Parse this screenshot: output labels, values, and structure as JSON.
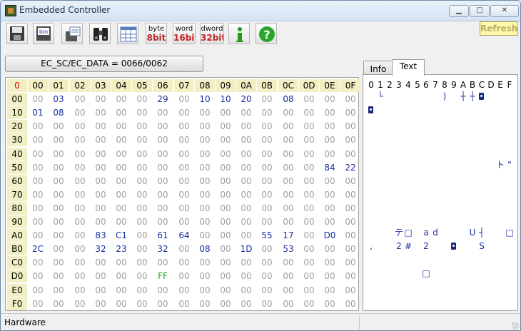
{
  "window": {
    "title": "Embedded Controller"
  },
  "toolbar": {
    "buttons": [
      {
        "icon": "save-icon"
      },
      {
        "label_top": "bin",
        "icon": "binary-file-icon"
      },
      {
        "icon": "open-file-icon"
      },
      {
        "icon": "binoculars-icon"
      },
      {
        "icon": "grid-view-icon"
      },
      {
        "label_top": "byte",
        "label_bottom": "8bit",
        "color": "#c0282a"
      },
      {
        "label_top": "word",
        "label_bottom": "16bit",
        "color": "#c0282a"
      },
      {
        "label_top": "dword",
        "label_bottom": "32bit",
        "color": "#c0282a"
      },
      {
        "icon": "info-icon"
      },
      {
        "icon": "help-icon"
      }
    ],
    "refresh_label": "Refresh"
  },
  "ec_port_label": "EC_SC/EC_DATA = 0066/0062",
  "grid": {
    "corner": "0",
    "col_headers": [
      "00",
      "01",
      "02",
      "03",
      "04",
      "05",
      "06",
      "07",
      "08",
      "09",
      "0A",
      "0B",
      "0C",
      "0D",
      "0E",
      "0F"
    ],
    "row_headers": [
      "00",
      "10",
      "20",
      "30",
      "40",
      "50",
      "60",
      "70",
      "80",
      "90",
      "A0",
      "B0",
      "C0",
      "D0",
      "E0",
      "F0"
    ],
    "rows": [
      [
        "00",
        "03",
        "00",
        "00",
        "00",
        "00",
        "29",
        "00",
        "10",
        "10",
        "20",
        "00",
        "08",
        "00",
        "00",
        "00"
      ],
      [
        "01",
        "08",
        "00",
        "00",
        "00",
        "00",
        "00",
        "00",
        "00",
        "00",
        "00",
        "00",
        "00",
        "00",
        "00",
        "00"
      ],
      [
        "00",
        "00",
        "00",
        "00",
        "00",
        "00",
        "00",
        "00",
        "00",
        "00",
        "00",
        "00",
        "00",
        "00",
        "00",
        "00"
      ],
      [
        "00",
        "00",
        "00",
        "00",
        "00",
        "00",
        "00",
        "00",
        "00",
        "00",
        "00",
        "00",
        "00",
        "00",
        "00",
        "00"
      ],
      [
        "00",
        "00",
        "00",
        "00",
        "00",
        "00",
        "00",
        "00",
        "00",
        "00",
        "00",
        "00",
        "00",
        "00",
        "00",
        "00"
      ],
      [
        "00",
        "00",
        "00",
        "00",
        "00",
        "00",
        "00",
        "00",
        "00",
        "00",
        "00",
        "00",
        "00",
        "00",
        "84",
        "22"
      ],
      [
        "00",
        "00",
        "00",
        "00",
        "00",
        "00",
        "00",
        "00",
        "00",
        "00",
        "00",
        "00",
        "00",
        "00",
        "00",
        "00"
      ],
      [
        "00",
        "00",
        "00",
        "00",
        "00",
        "00",
        "00",
        "00",
        "00",
        "00",
        "00",
        "00",
        "00",
        "00",
        "00",
        "00"
      ],
      [
        "00",
        "00",
        "00",
        "00",
        "00",
        "00",
        "00",
        "00",
        "00",
        "00",
        "00",
        "00",
        "00",
        "00",
        "00",
        "00"
      ],
      [
        "00",
        "00",
        "00",
        "00",
        "00",
        "00",
        "00",
        "00",
        "00",
        "00",
        "00",
        "00",
        "00",
        "00",
        "00",
        "00"
      ],
      [
        "00",
        "00",
        "00",
        "83",
        "C1",
        "00",
        "61",
        "64",
        "00",
        "00",
        "00",
        "55",
        "17",
        "00",
        "D0",
        "00"
      ],
      [
        "2C",
        "00",
        "00",
        "32",
        "23",
        "00",
        "32",
        "00",
        "08",
        "00",
        "1D",
        "00",
        "53",
        "00",
        "00",
        "00"
      ],
      [
        "00",
        "00",
        "00",
        "00",
        "00",
        "00",
        "00",
        "00",
        "00",
        "00",
        "00",
        "00",
        "00",
        "00",
        "00",
        "00"
      ],
      [
        "00",
        "00",
        "00",
        "00",
        "00",
        "00",
        "FF",
        "00",
        "00",
        "00",
        "00",
        "00",
        "00",
        "00",
        "00",
        "00"
      ],
      [
        "00",
        "00",
        "00",
        "00",
        "00",
        "00",
        "00",
        "00",
        "00",
        "00",
        "00",
        "00",
        "00",
        "00",
        "00",
        "00"
      ],
      [
        "00",
        "00",
        "00",
        "00",
        "00",
        "00",
        "00",
        "00",
        "00",
        "00",
        "00",
        "00",
        "00",
        "00",
        "00",
        "00"
      ]
    ]
  },
  "tabs": [
    {
      "label": "Info"
    },
    {
      "label": "Text"
    }
  ],
  "text_view": {
    "headers": [
      "0",
      "1",
      "2",
      "3",
      "4",
      "5",
      "6",
      "7",
      "8",
      "9",
      "A",
      "B",
      "C",
      "D",
      "E",
      "F"
    ],
    "lines": [
      [
        "",
        "└",
        "",
        "",
        "",
        "",
        "",
        "",
        ")",
        "",
        "┼",
        "┼",
        "",
        "",
        "",
        ""
      ],
      [
        "",
        "",
        "",
        "",
        "",
        "",
        "",
        "",
        "",
        "",
        "",
        "",
        "",
        "",
        "",
        ""
      ],
      [
        "",
        "",
        "",
        "",
        "",
        "",
        "",
        "",
        "",
        "",
        "",
        "",
        "",
        "",
        "",
        ""
      ],
      [
        "",
        "",
        "",
        "",
        "",
        "",
        "",
        "",
        "",
        "",
        "",
        "",
        "",
        "",
        "",
        ""
      ],
      [
        "",
        "",
        "",
        "",
        "",
        "",
        "",
        "",
        "",
        "",
        "",
        "",
        "",
        "",
        "",
        ""
      ],
      [
        "",
        "",
        "",
        "",
        "",
        "",
        "",
        "",
        "",
        "",
        "",
        "",
        "",
        "",
        "ト",
        "\""
      ],
      [
        "",
        "",
        "",
        "",
        "",
        "",
        "",
        "",
        "",
        "",
        "",
        "",
        "",
        "",
        "",
        ""
      ],
      [
        "",
        "",
        "",
        "",
        "",
        "",
        "",
        "",
        "",
        "",
        "",
        "",
        "",
        "",
        "",
        ""
      ],
      [
        "",
        "",
        "",
        "",
        "",
        "",
        "",
        "",
        "",
        "",
        "",
        "",
        "",
        "",
        "",
        ""
      ],
      [
        "",
        "",
        "",
        "",
        "",
        "",
        "",
        "",
        "",
        "",
        "",
        "",
        "",
        "",
        "",
        ""
      ],
      [
        "",
        "",
        "",
        "テ",
        "□",
        "",
        "a",
        "d",
        "",
        "",
        "",
        "U",
        "┤",
        "",
        "",
        "□"
      ],
      [
        ",",
        "",
        "",
        "2",
        "#",
        "",
        "2",
        "",
        "",
        "",
        "",
        "",
        "S",
        "",
        "",
        ""
      ],
      [
        "",
        "",
        "",
        "",
        "",
        "",
        "",
        "",
        "",
        "",
        "",
        "",
        "",
        "",
        "",
        ""
      ],
      [
        "",
        "",
        "",
        "",
        "",
        "",
        "□",
        "",
        "",
        "",
        "",
        "",
        "",
        "",
        "",
        ""
      ],
      [
        "",
        "",
        "",
        "",
        "",
        "",
        "",
        "",
        "",
        "",
        "",
        "",
        "",
        "",
        "",
        ""
      ],
      [
        "",
        "",
        "",
        "",
        "",
        "",
        "",
        "",
        "",
        "",
        "",
        "",
        "",
        "",
        "",
        ""
      ]
    ],
    "bullets": [
      [
        0,
        12
      ],
      [
        1,
        0
      ],
      [
        11,
        9
      ]
    ]
  },
  "status": {
    "label": "Hardware"
  }
}
